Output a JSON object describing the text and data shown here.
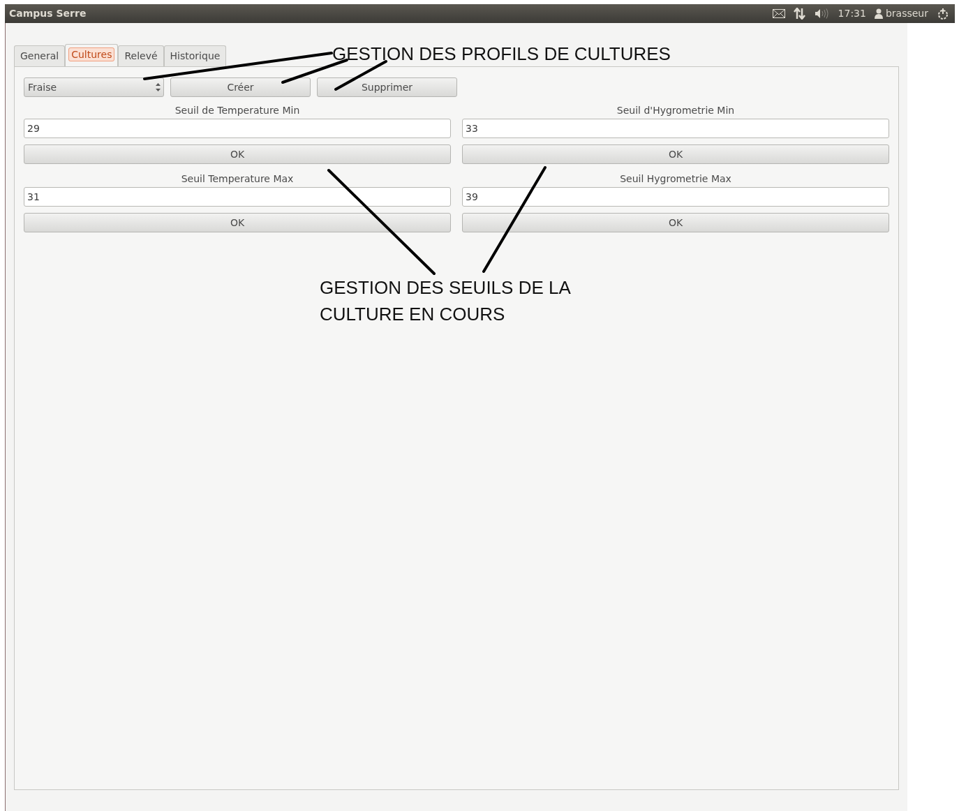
{
  "top_bar": {
    "title": "Campus Serre",
    "time": "17:31",
    "user": "brasseur"
  },
  "tabs": [
    {
      "label": "General",
      "selected": false
    },
    {
      "label": "Cultures",
      "selected": true
    },
    {
      "label": "Relevé",
      "selected": false
    },
    {
      "label": "Historique",
      "selected": false
    }
  ],
  "profile_bar": {
    "combo_value": "Fraise",
    "buttons": [
      "Créer",
      "Supprimer"
    ]
  },
  "thresholds": [
    {
      "label": "Seuil de Temperature Min",
      "value": "29",
      "button": "OK"
    },
    {
      "label": "Seuil d'Hygrometrie Min",
      "value": "33",
      "button": "OK"
    },
    {
      "label": "Seuil Temperature Max",
      "value": "31",
      "button": "OK"
    },
    {
      "label": "Seuil Hygrometrie Max",
      "value": "39",
      "button": "OK"
    }
  ],
  "annotations": [
    {
      "text": "GESTION DES PROFILS DE CULTURES"
    },
    {
      "text": "GESTION DES SEUILS DE LA CULTURE EN COURS"
    }
  ]
}
